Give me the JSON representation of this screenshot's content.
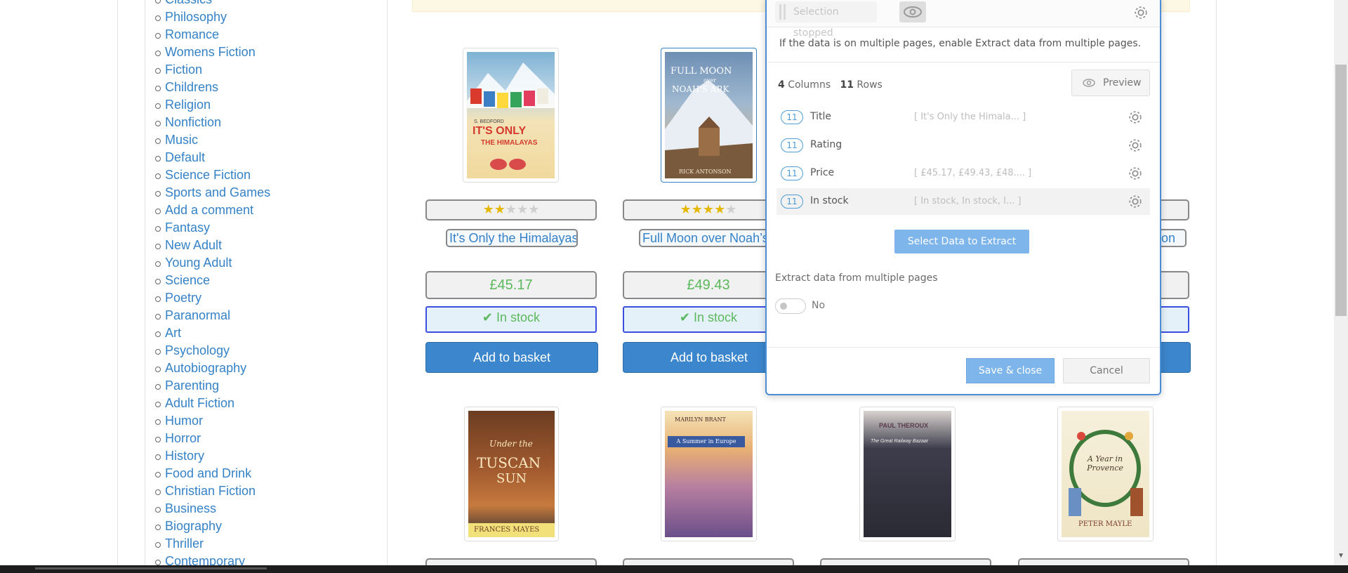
{
  "sidebar": {
    "categories": [
      "Classics",
      "Philosophy",
      "Romance",
      "Womens Fiction",
      "Fiction",
      "Childrens",
      "Religion",
      "Nonfiction",
      "Music",
      "Default",
      "Science Fiction",
      "Sports and Games",
      "Add a comment",
      "Fantasy",
      "New Adult",
      "Young Adult",
      "Science",
      "Poetry",
      "Paranormal",
      "Art",
      "Psychology",
      "Autobiography",
      "Parenting",
      "Adult Fiction",
      "Humor",
      "Horror",
      "History",
      "Food and Drink",
      "Christian Fiction",
      "Business",
      "Biography",
      "Thriller",
      "Contemporary"
    ]
  },
  "products": [
    {
      "cover_lines": [
        "S. BEDFORD",
        "IT'S ONLY",
        "THE HIMALAYAS"
      ],
      "rating": 2,
      "title": "It's Only the Himalayas",
      "price": "£45.17",
      "stock": "In stock",
      "basket": "Add to basket"
    },
    {
      "cover_lines": [
        "FULL MOON",
        "over",
        "NOAH'S ARK",
        "RICK ANTONSON"
      ],
      "rating": 4,
      "title": "Full Moon over Noah’s",
      "price": "£49.43",
      "stock": "In stock",
      "basket": "Add to basket"
    },
    {
      "title_partial": "mon"
    }
  ],
  "second_row": [
    {
      "cover_lines": [
        "Under the",
        "TUSCAN",
        "SUN",
        "FRANCES MAYES"
      ]
    },
    {
      "cover_lines": [
        "MARILYN BRANT",
        "A Summer in Europe"
      ]
    },
    {
      "cover_lines": [
        "PAUL THEROUX",
        "The Great Railway Bazaar"
      ]
    },
    {
      "cover_lines": [
        "A Year in Provence",
        "PETER MAYLE"
      ]
    }
  ],
  "panel": {
    "selection_status": "Selection stopped",
    "info": "If the data is on multiple pages, enable Extract data from multiple pages.",
    "columns_count": "4",
    "columns_label": "Columns",
    "rows_count": "11",
    "rows_label": "Rows",
    "preview_label": "Preview",
    "columns": [
      {
        "count": "11",
        "name": "Title",
        "preview": "[ It's Only the Himala... ]"
      },
      {
        "count": "11",
        "name": "Rating",
        "preview": ""
      },
      {
        "count": "11",
        "name": "Price",
        "preview": "[ £45.17, £49.43, £48.... ]"
      },
      {
        "count": "11",
        "name": "In stock",
        "preview": "[  In stock,  In stock,  I... ]"
      }
    ],
    "select_data_label": "Select Data to Extract",
    "multi_page_label": "Extract data from multiple pages",
    "multi_page_value": "No",
    "save_label": "Save & close",
    "cancel_label": "Cancel"
  },
  "colors": {
    "link": "#3582c7",
    "price_green": "#5cb85c",
    "button_blue": "#3b86cc",
    "panel_accent": "#4a8fd5"
  }
}
